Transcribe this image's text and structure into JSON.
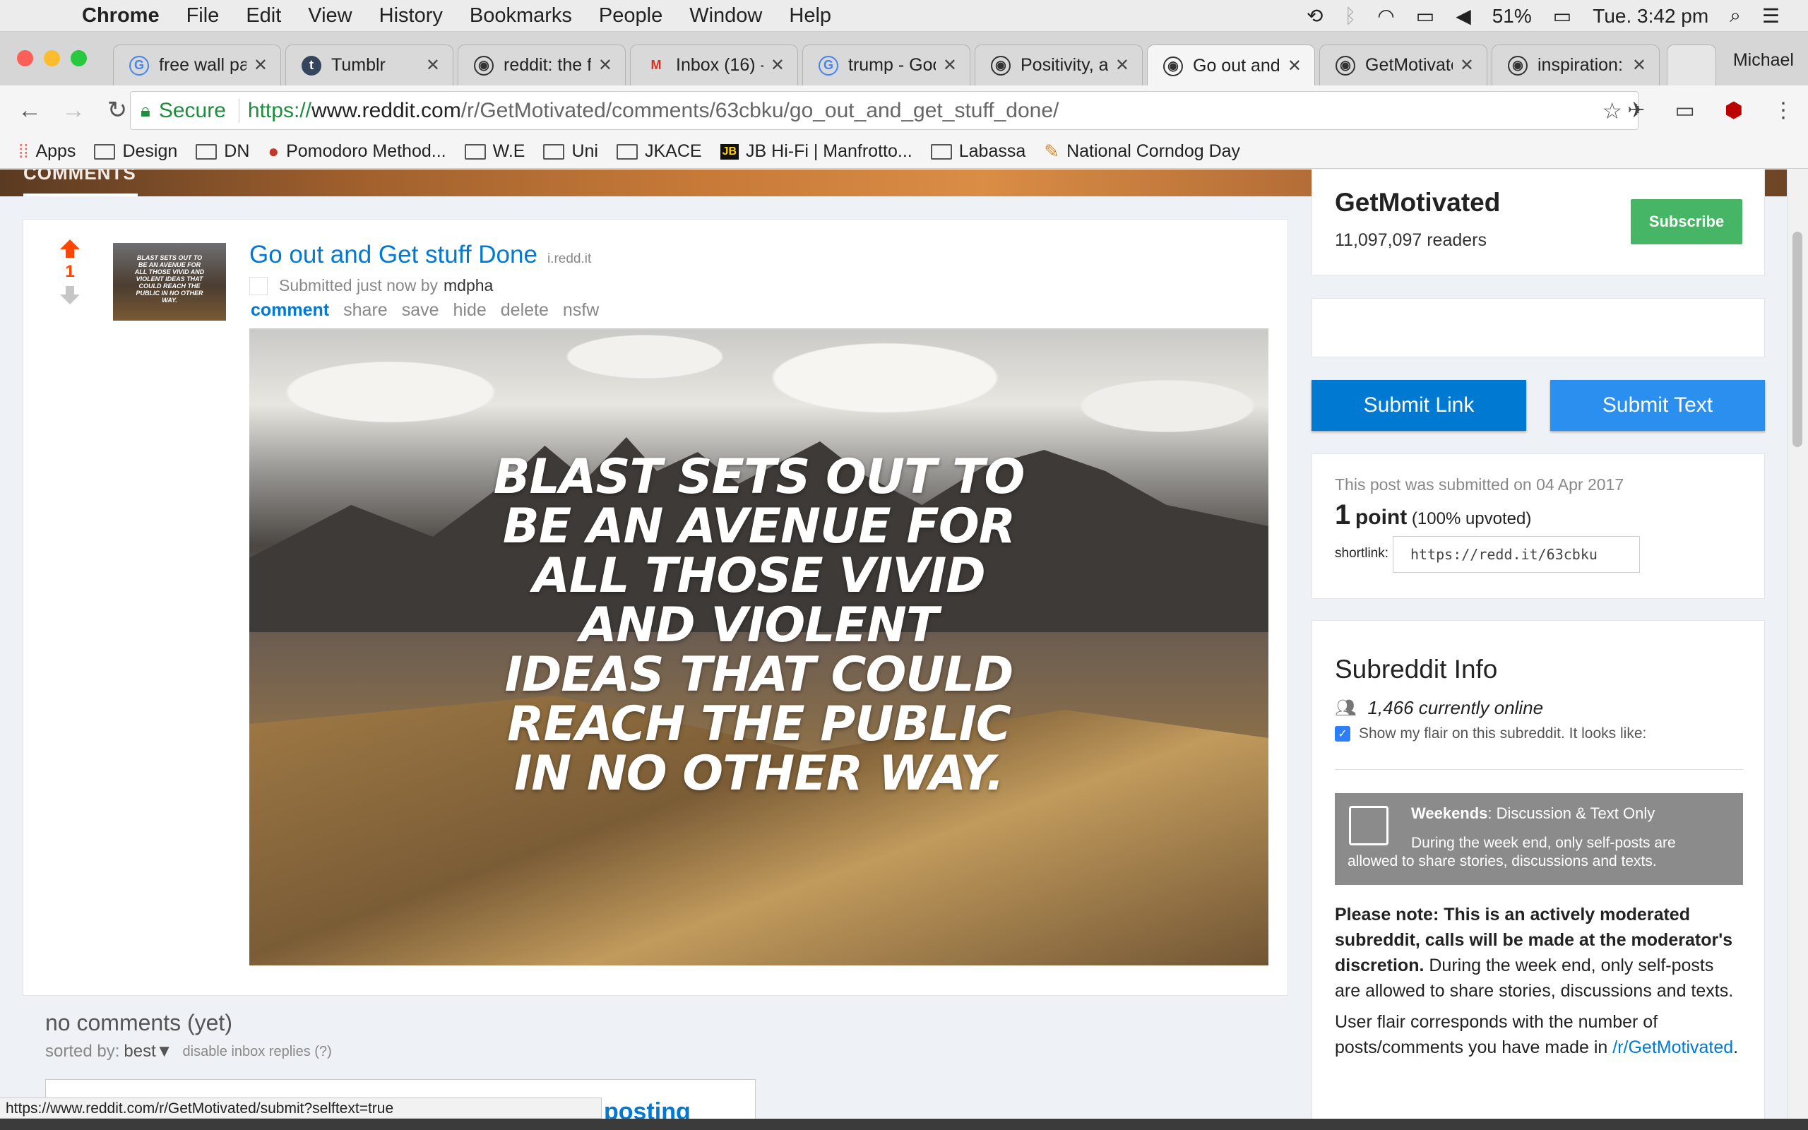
{
  "menubar": {
    "app": "Chrome",
    "items": [
      "File",
      "Edit",
      "View",
      "History",
      "Bookmarks",
      "People",
      "Window",
      "Help"
    ],
    "battery": "51%",
    "clock": "Tue. 3:42 pm"
  },
  "tabs": [
    {
      "title": "free wall pa",
      "icon": "google-icon"
    },
    {
      "title": "Tumblr",
      "icon": "tumblr-icon"
    },
    {
      "title": "reddit: the f",
      "icon": "reddit-icon"
    },
    {
      "title": "Inbox (16) -",
      "icon": "gmail-icon"
    },
    {
      "title": "trump - Goo",
      "icon": "google-icon"
    },
    {
      "title": "Positivity, a",
      "icon": "reddit-icon"
    },
    {
      "title": "Go out and",
      "icon": "reddit-icon"
    },
    {
      "title": "GetMotivate",
      "icon": "reddit-icon"
    },
    {
      "title": "inspiration:",
      "icon": "reddit-icon"
    }
  ],
  "profile_name": "Michael",
  "omnibox": {
    "secure_label": "Secure",
    "url_scheme": "https://",
    "url_host": "www.reddit.com",
    "url_path": "/r/GetMotivated/comments/63cbku/go_out_and_get_stuff_done/"
  },
  "bookmarks": [
    {
      "label": "Apps",
      "icon": "apps-grid-icon"
    },
    {
      "label": "Design",
      "icon": "folder-icon"
    },
    {
      "label": "DN",
      "icon": "folder-icon"
    },
    {
      "label": "Pomodoro Method...",
      "icon": "tomato-icon"
    },
    {
      "label": "W.E",
      "icon": "folder-icon"
    },
    {
      "label": "Uni",
      "icon": "folder-icon"
    },
    {
      "label": "JKACE",
      "icon": "folder-icon"
    },
    {
      "label": "JB Hi-Fi | Manfrotto...",
      "icon": "jbhifi-icon"
    },
    {
      "label": "Labassa",
      "icon": "folder-icon"
    },
    {
      "label": "National Corndog Day",
      "icon": "corndog-icon"
    }
  ],
  "banner": {
    "comments_label": "COMMENTS"
  },
  "post": {
    "score": "1",
    "title": "Go out and Get stuff Done",
    "domain": "i.redd.it",
    "submitted_prefix": "Submitted just now by",
    "author": "mdpha",
    "actions": [
      "comment",
      "share",
      "save",
      "hide",
      "delete",
      "nsfw"
    ],
    "thumb_text": "BLAST SETS OUT TO BE AN AVENUE FOR ALL THOSE VIVID AND VIOLENT IDEAS THAT COULD REACH THE PUBLIC IN NO OTHER WAY.",
    "image_quote_lines": [
      "BLAST SETS OUT TO",
      "BE AN AVENUE FOR",
      "ALL THOSE VIVID",
      "AND VIOLENT",
      "IDEAS THAT COULD",
      "REACH THE PUBLIC",
      "IN NO OTHER WAY."
    ]
  },
  "comments": {
    "heading": "no comments (yet)",
    "sorted_label": "sorted by:",
    "sort_value": "best▼",
    "disable_replies": "disable inbox replies (?)",
    "box_partial_text": "posting"
  },
  "sidebar": {
    "sub_name": "GetMotivated",
    "readers": "11,097,097 readers",
    "subscribe": "Subscribe",
    "submit_link": "Submit Link",
    "submit_text": "Submit Text",
    "submitted_on": "This post was submitted on 04 Apr 2017",
    "points_num": "1",
    "points_word": "point",
    "upvoted": "(100% upvoted)",
    "shortlink_label": "shortlink:",
    "shortlink": "https://redd.it/63cbku",
    "info_title": "Subreddit Info",
    "online": "1,466 currently online",
    "flair_text": "Show my flair on this subreddit. It looks like:",
    "weekend_title_bold": "Weekends",
    "weekend_title_rest": ": Discussion & Text Only",
    "weekend_desc": "During the week end, only self-posts are allowed to share stories, discussions and texts.",
    "note_bold": "Please note: This is an actively moderated subreddit, calls will be made at the moderator's discretion.",
    "note_rest": " During the week end, only self-posts are allowed to share stories, discussions and texts.",
    "flair_note": "User flair corresponds with the number of posts/comments you have made in",
    "flair_link": "/r/GetMotivated",
    "flair_end": "."
  },
  "status_url": "https://www.reddit.com/r/GetMotivated/submit?selftext=true",
  "colors": {
    "reddit_blue": "#0079d3",
    "orangered": "#ff4500",
    "subscribe_green": "#46b565",
    "submit_blue": "#0079d3"
  }
}
